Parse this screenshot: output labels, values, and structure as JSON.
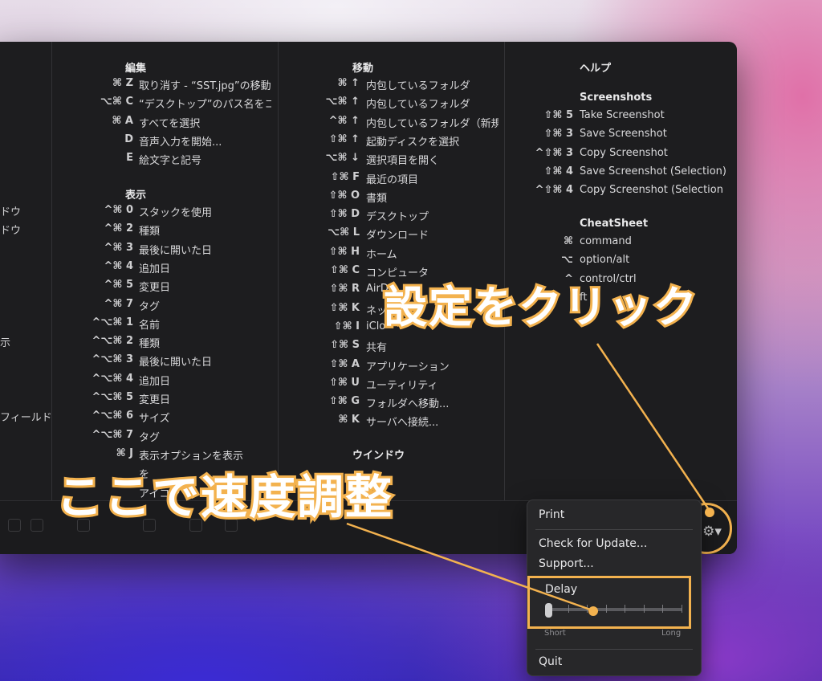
{
  "left_column_fragments": [
    "ドウ",
    "ドウ",
    "示",
    "フィールド"
  ],
  "edit": {
    "heading": "編集",
    "items": [
      {
        "keys": "⌘ Z",
        "label": "取り消す - “SST.jpg”の移動"
      },
      {
        "keys": "⌥⌘ C",
        "label": "“デスクトップ”のパス名をコ"
      },
      {
        "keys": "⌘ A",
        "label": "すべてを選択"
      },
      {
        "keys": "D",
        "label": "音声入力を開始..."
      },
      {
        "keys": "E",
        "label": "絵文字と記号"
      }
    ]
  },
  "view": {
    "heading": "表示",
    "items": [
      {
        "keys": "^⌘ 0",
        "label": "スタックを使用"
      },
      {
        "keys": "^⌘ 2",
        "label": "種類"
      },
      {
        "keys": "^⌘ 3",
        "label": "最後に開いた日"
      },
      {
        "keys": "^⌘ 4",
        "label": "追加日"
      },
      {
        "keys": "^⌘ 5",
        "label": "変更日"
      },
      {
        "keys": "^⌘ 7",
        "label": "タグ"
      },
      {
        "keys": "^⌥⌘ 1",
        "label": "名前"
      },
      {
        "keys": "^⌥⌘ 2",
        "label": "種類"
      },
      {
        "keys": "^⌥⌘ 3",
        "label": "最後に開いた日"
      },
      {
        "keys": "^⌥⌘ 4",
        "label": "追加日"
      },
      {
        "keys": "^⌥⌘ 5",
        "label": "変更日"
      },
      {
        "keys": "^⌥⌘ 6",
        "label": "サイズ"
      },
      {
        "keys": "^⌥⌘ 7",
        "label": "タグ"
      },
      {
        "keys": "⌘ J",
        "label": "表示オプションを表示"
      },
      {
        "keys": "",
        "label": "を"
      },
      {
        "keys": "",
        "label": "アイコン"
      }
    ]
  },
  "move": {
    "heading": "移動",
    "items": [
      {
        "keys": "⌘ ↑",
        "label": "内包しているフォルダ"
      },
      {
        "keys": "⌥⌘ ↑",
        "label": "内包しているフォルダ"
      },
      {
        "keys": "^⌘ ↑",
        "label": "内包しているフォルダ（新規"
      },
      {
        "keys": "⇧⌘ ↑",
        "label": "起動ディスクを選択"
      },
      {
        "keys": "⌥⌘ ↓",
        "label": "選択項目を開く"
      },
      {
        "keys": "⇧⌘ F",
        "label": "最近の項目"
      },
      {
        "keys": "⇧⌘ O",
        "label": "書類"
      },
      {
        "keys": "⇧⌘ D",
        "label": "デスクトップ"
      },
      {
        "keys": "⌥⌘ L",
        "label": "ダウンロード"
      },
      {
        "keys": "⇧⌘ H",
        "label": "ホーム"
      },
      {
        "keys": "⇧⌘ C",
        "label": "コンピュータ"
      },
      {
        "keys": "⇧⌘ R",
        "label": "AirD"
      },
      {
        "keys": "⇧⌘ K",
        "label": "ネッ"
      },
      {
        "keys": "⇧⌘ I",
        "label": "iClo"
      },
      {
        "keys": "⇧⌘ S",
        "label": "共有"
      },
      {
        "keys": "⇧⌘ A",
        "label": "アプリケーション"
      },
      {
        "keys": "⇧⌘ U",
        "label": "ユーティリティ"
      },
      {
        "keys": "⇧⌘ G",
        "label": "フォルダへ移動..."
      },
      {
        "keys": "⌘ K",
        "label": "サーバへ接続..."
      }
    ],
    "window_heading": "ウインドウ"
  },
  "help": {
    "heading": "ヘルプ",
    "screenshots_heading": "Screenshots",
    "screenshots": [
      {
        "keys": "⇧⌘ 5",
        "label": "Take Screenshot"
      },
      {
        "keys": "⇧⌘ 3",
        "label": "Save Screenshot"
      },
      {
        "keys": "^⇧⌘ 3",
        "label": "Copy Screenshot"
      },
      {
        "keys": "⇧⌘ 4",
        "label": "Save Screenshot (Selection)"
      },
      {
        "keys": "^⇧⌘ 4",
        "label": "Copy Screenshot (Selection"
      }
    ],
    "cheatsheet_heading": "CheatSheet",
    "legend": [
      {
        "keys": "⌘",
        "label": "command"
      },
      {
        "keys": "⌥",
        "label": "option/alt"
      },
      {
        "keys": "^",
        "label": "control/ctrl"
      },
      {
        "keys": "",
        "label": "ft"
      }
    ]
  },
  "gear_icon": "⚙▾",
  "menu": {
    "print": "Print",
    "check_update": "Check for Update...",
    "support": "Support...",
    "delay_label": "Delay",
    "delay_value": 0.0,
    "short_label": "Short",
    "long_label": "Long",
    "quit": "Quit"
  },
  "annotations": {
    "click_settings": "設定をクリック",
    "adjust_speed": "ここで速度調整"
  },
  "colors": {
    "accent": "#f3b24f",
    "window_bg": "#1d1d1f",
    "menu_bg": "#272729"
  }
}
